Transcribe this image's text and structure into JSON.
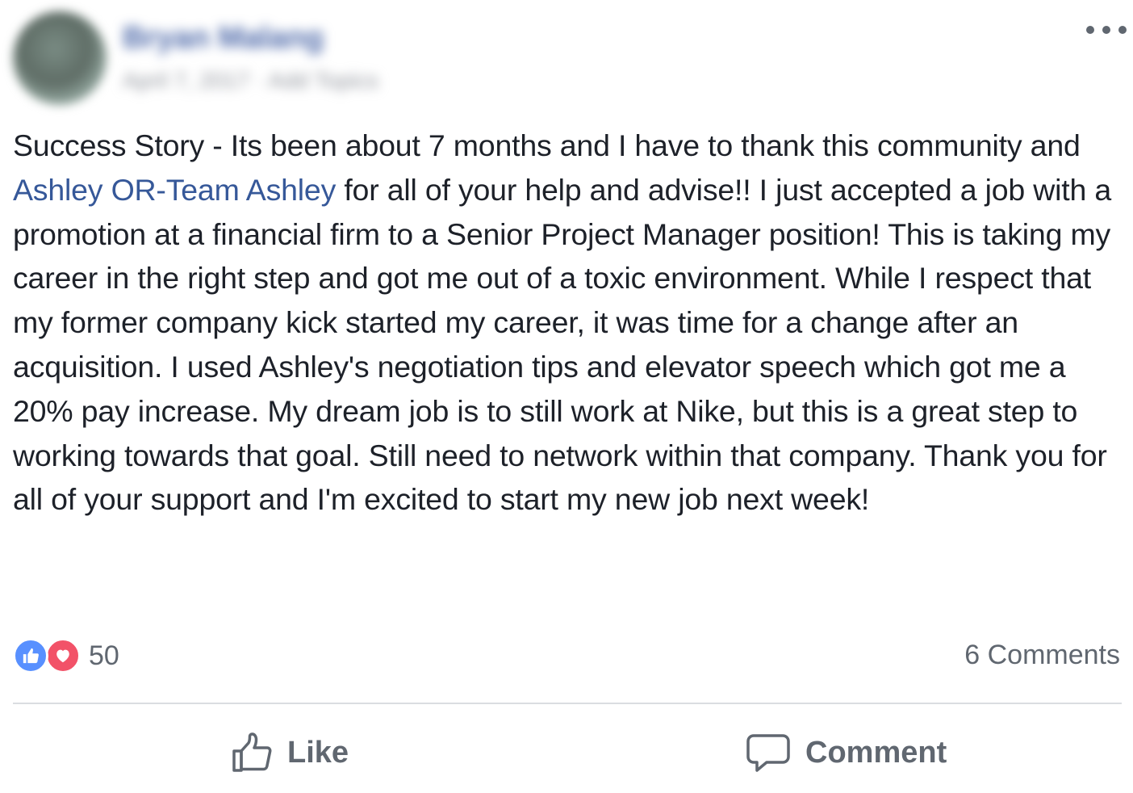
{
  "header": {
    "author_name": "Bryan Malang",
    "meta_text": "April 7, 2017 · Add Topics",
    "more_icon": "more-horizontal-icon"
  },
  "post": {
    "text_before_mention": "Success Story - Its been about 7 months and I have to thank this community and ",
    "mention": "Ashley OR-Team Ashley",
    "text_after_mention": " for all of your help and advise!! I just accepted a job with a promotion at a financial firm to a Senior Project Manager position! This is taking my career in the right step and got me out of a toxic environment. While I respect that my former company kick started my career, it was time for a change after an acquisition. I used Ashley's negotiation tips and elevator speech which got me a 20% pay increase. My dream job is to still work at Nike, but this is a great step to working towards that goal. Still need to network within that company. Thank you for all of your support and I'm excited to start my new job next week!"
  },
  "reactions": {
    "icons": [
      "like-reaction-icon",
      "love-reaction-icon"
    ],
    "count": "50",
    "comments_label": "6 Comments"
  },
  "actions": {
    "like_label": "Like",
    "comment_label": "Comment"
  },
  "colors": {
    "link": "#365899",
    "like_blue": "#5890ff",
    "love_red": "#f25268",
    "secondary_text": "#606770",
    "divider": "#dadde1"
  }
}
